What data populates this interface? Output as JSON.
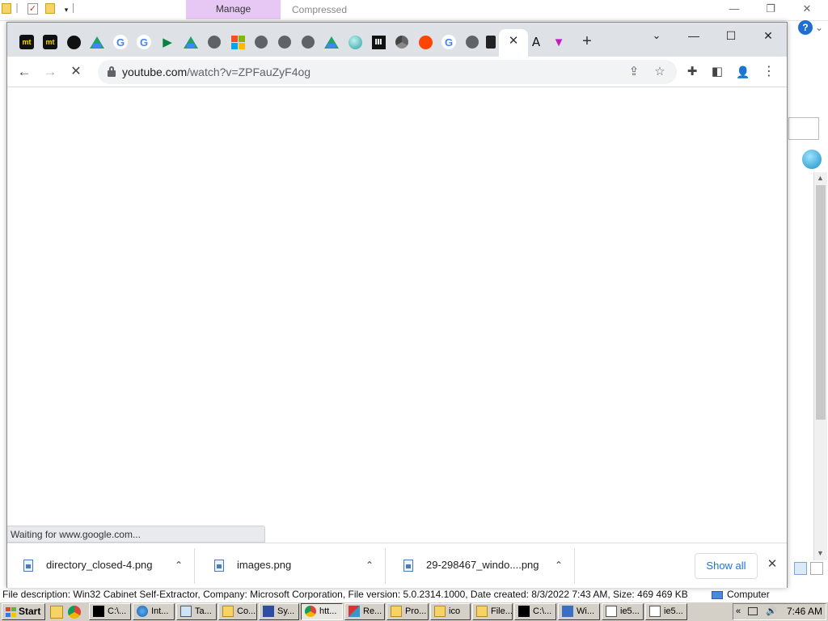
{
  "background_window": {
    "manage_tab": "Manage",
    "compressed_label": "Compressed",
    "file_description": "File description: Win32 Cabinet Self-Extractor, Company: Microsoft Corporation, File version: 5.0.2314.1000, Date created: 8/3/2022 7:43 AM, Size: 469 469 KB",
    "computer_label": "Computer"
  },
  "browser": {
    "pinned_tabs": [
      {
        "icon": "mt-icon",
        "glyph": "mt"
      },
      {
        "icon": "mt-icon",
        "glyph": "mt"
      },
      {
        "icon": "github-icon",
        "glyph": "⬤"
      },
      {
        "icon": "google-drive-icon",
        "glyph": "▲"
      },
      {
        "icon": "google-icon",
        "glyph": "G"
      },
      {
        "icon": "google-icon",
        "glyph": "G"
      },
      {
        "icon": "play-icon",
        "glyph": "▶"
      },
      {
        "icon": "google-drive-icon",
        "glyph": "▲"
      },
      {
        "icon": "globe-icon",
        "glyph": "🌐"
      },
      {
        "icon": "microsoft-icon",
        "glyph": ""
      },
      {
        "icon": "globe-icon",
        "glyph": "🌐"
      },
      {
        "icon": "globe-icon",
        "glyph": "🌐"
      },
      {
        "icon": "globe-icon",
        "glyph": "🌐"
      },
      {
        "icon": "google-drive-icon",
        "glyph": "▲"
      },
      {
        "icon": "teal-sphere-icon",
        "glyph": ""
      },
      {
        "icon": "museum-icon",
        "glyph": "Ⅲ"
      },
      {
        "icon": "chrome-icon",
        "glyph": ""
      },
      {
        "icon": "reddit-icon",
        "glyph": "●"
      },
      {
        "icon": "google-icon",
        "glyph": "G"
      },
      {
        "icon": "globe-icon",
        "glyph": "🌐"
      },
      {
        "icon": "door-icon",
        "glyph": ""
      }
    ],
    "extra_tabs": [
      {
        "icon": "font-a-icon",
        "glyph": "A"
      },
      {
        "icon": "v-logo-icon",
        "glyph": "▼"
      }
    ],
    "new_tab_glyph": "+",
    "close_tab_glyph": "✕",
    "url_host": "youtube.com",
    "url_path": "/watch?v=ZPFauZyF4og",
    "status_text": "Waiting for www.google.com...",
    "downloads": [
      {
        "name": "directory_closed-4.png"
      },
      {
        "name": "images.png"
      },
      {
        "name": "29-298467_windo....png"
      }
    ],
    "show_all_label": "Show all"
  },
  "taskbar": {
    "start_label": "Start",
    "items": [
      {
        "label": "C:\\...",
        "icon": "7zip-icon",
        "active": false
      },
      {
        "label": "Int...",
        "icon": "ie-icon",
        "active": false
      },
      {
        "label": "Ta...",
        "icon": "task-manager-icon",
        "active": false
      },
      {
        "label": "Co...",
        "icon": "folder-icon",
        "active": false
      },
      {
        "label": "Sy...",
        "icon": "system-icon",
        "active": false
      },
      {
        "label": "htt...",
        "icon": "chrome-icon",
        "active": true
      },
      {
        "label": "Re...",
        "icon": "registry-icon",
        "active": false
      },
      {
        "label": "Pro...",
        "icon": "folder-icon",
        "active": false
      },
      {
        "label": "ico",
        "icon": "folder-icon",
        "active": false
      },
      {
        "label": "File...",
        "icon": "folder-icon",
        "active": false
      },
      {
        "label": "C:\\...",
        "icon": "7zip-icon",
        "active": false
      },
      {
        "label": "Wi...",
        "icon": "windows-icon",
        "active": false
      },
      {
        "label": "ie5...",
        "icon": "setup-icon",
        "active": false
      },
      {
        "label": "ie5...",
        "icon": "setup-icon",
        "active": false
      }
    ],
    "tray_arrow": "«",
    "clock": "7:46 AM"
  },
  "colors": {
    "manage_tab_bg": "#e7c8f5",
    "tabstrip_bg": "#dee1e6",
    "show_all_text": "#1a73e8",
    "taskbar_bg": "#d4d0c8"
  }
}
